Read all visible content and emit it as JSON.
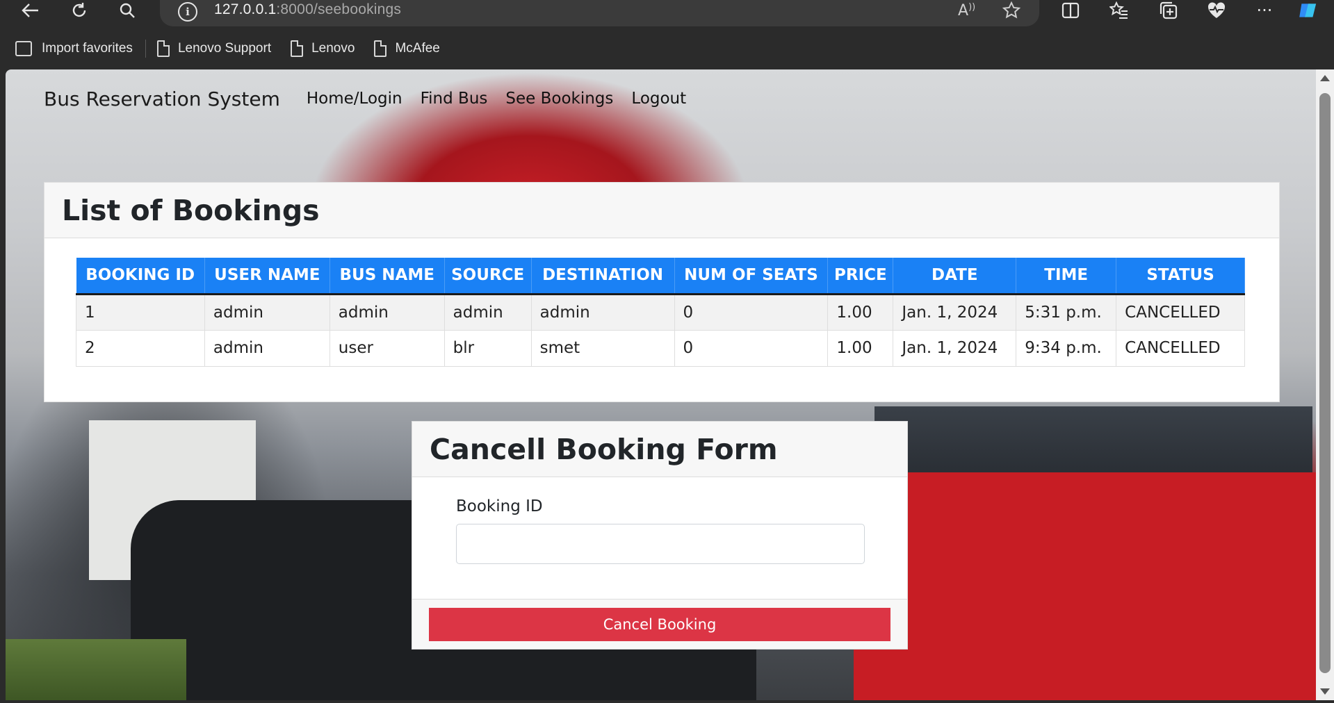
{
  "browser": {
    "url_host": "127.0.0.1",
    "url_path": ":8000/seebookings",
    "bookmarks": [
      {
        "label": "Import favorites"
      },
      {
        "label": "Lenovo Support"
      },
      {
        "label": "Lenovo"
      },
      {
        "label": "McAfee"
      }
    ],
    "icons": [
      "back-icon",
      "refresh-icon",
      "search-icon",
      "info-icon",
      "read-aloud-icon",
      "favorite-star-icon",
      "split-screen-icon",
      "favorites-icon",
      "collections-icon",
      "browser-essentials-icon",
      "more-icon",
      "copilot-icon"
    ]
  },
  "navbar": {
    "brand": "Bus Reservation System",
    "links": [
      "Home/Login",
      "Find Bus",
      "See Bookings",
      "Logout"
    ]
  },
  "bookings": {
    "title": "List of Bookings",
    "columns": [
      "BOOKING ID",
      "USER NAME",
      "BUS NAME",
      "SOURCE",
      "DESTINATION",
      "NUM OF SEATS",
      "PRICE",
      "DATE",
      "TIME",
      "STATUS"
    ],
    "rows": [
      [
        "1",
        "admin",
        "admin",
        "admin",
        "admin",
        "0",
        "1.00",
        "Jan. 1, 2024",
        "5:31 p.m.",
        "CANCELLED"
      ],
      [
        "2",
        "admin",
        "user",
        "blr",
        "smet",
        "0",
        "1.00",
        "Jan. 1, 2024",
        "9:34 p.m.",
        "CANCELLED"
      ]
    ],
    "header_color": "#1a81f5"
  },
  "cancel_form": {
    "title": "Cancell Booking Form",
    "label": "Booking ID",
    "input_value": "",
    "button_label": "Cancel Booking",
    "button_color": "#dc3545"
  }
}
